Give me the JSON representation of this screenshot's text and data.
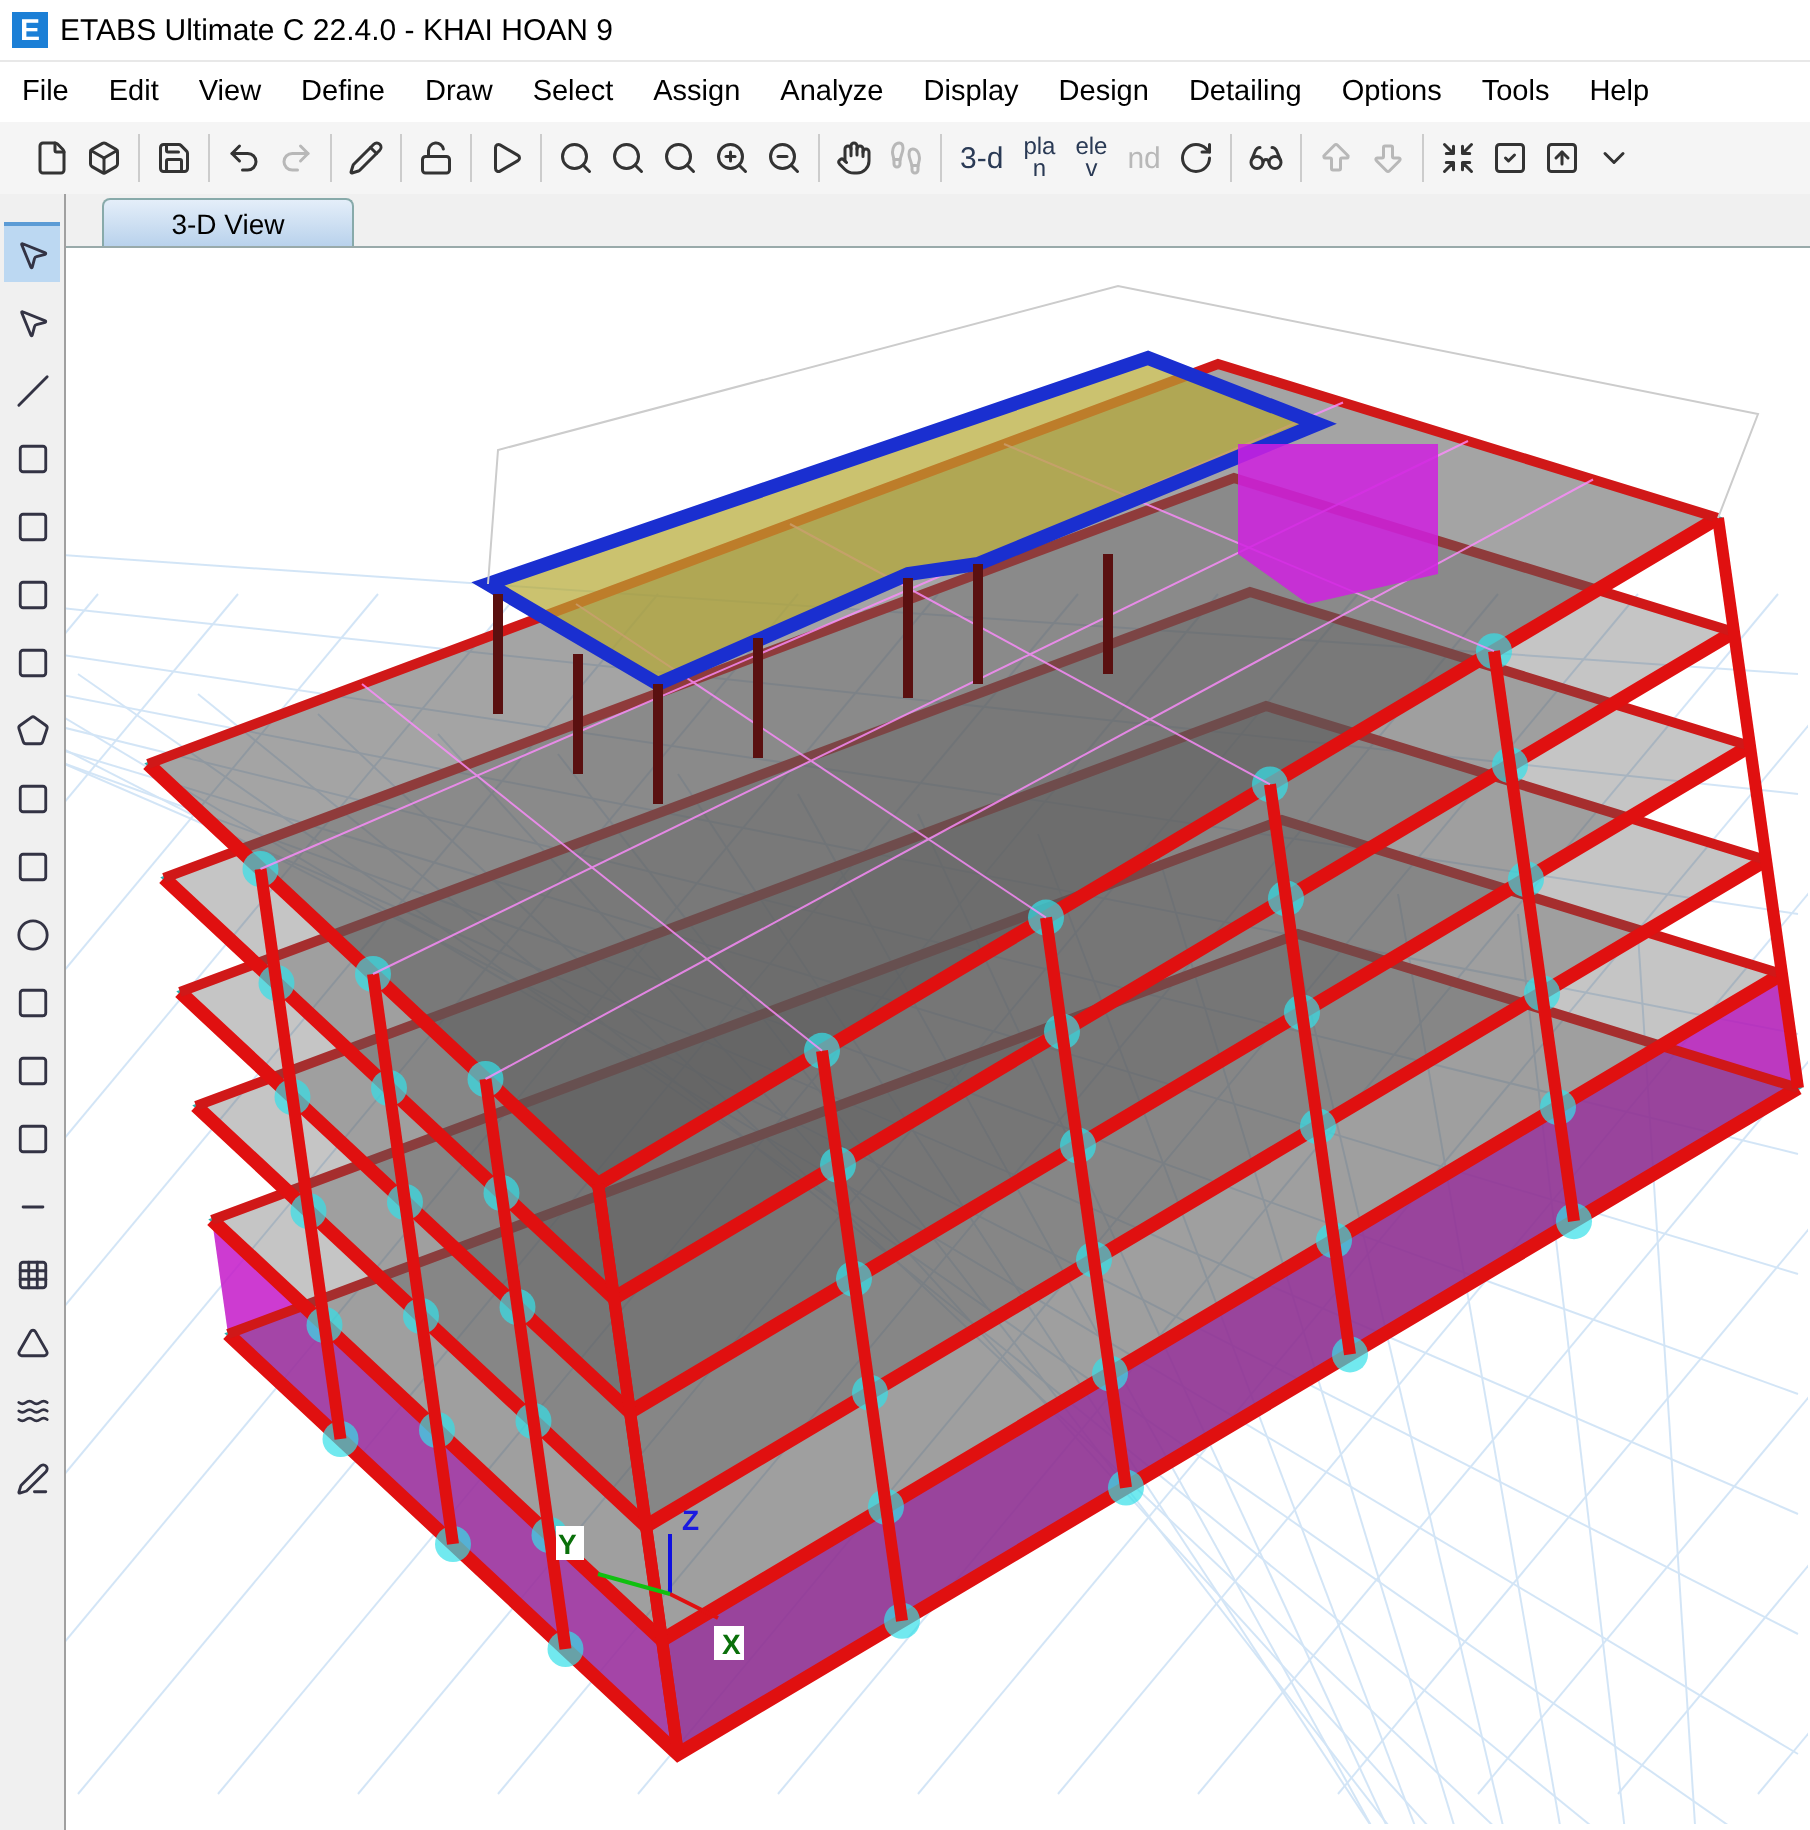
{
  "window": {
    "logo_letter": "E",
    "title": "ETABS Ultimate C 22.4.0 - KHAI HOAN 9"
  },
  "menu": [
    "File",
    "Edit",
    "View",
    "Define",
    "Draw",
    "Select",
    "Assign",
    "Analyze",
    "Display",
    "Design",
    "Detailing",
    "Options",
    "Tools",
    "Help"
  ],
  "toolbar_view_buttons": [
    {
      "kind": "text",
      "label": "3-d",
      "disabled": false
    },
    {
      "kind": "stacked",
      "top": "pla",
      "bottom": "n",
      "disabled": false
    },
    {
      "kind": "stacked",
      "top": "ele",
      "bottom": "v",
      "disabled": false
    },
    {
      "kind": "text",
      "label": "nd",
      "disabled": true
    }
  ],
  "tabs": [
    {
      "label": "3-D View",
      "selected": true
    }
  ],
  "side_tools": [
    {
      "selected": true
    },
    {
      "selected": false
    },
    {
      "selected": false
    },
    {
      "selected": false
    },
    {
      "selected": false
    },
    {
      "selected": false
    },
    {
      "selected": false
    },
    {
      "selected": false
    },
    {
      "selected": false
    },
    {
      "selected": false
    },
    {
      "selected": false
    },
    {
      "selected": false
    },
    {
      "selected": false
    },
    {
      "selected": false
    },
    {
      "selected": false
    },
    {
      "selected": false
    },
    {
      "selected": false
    },
    {
      "selected": false
    },
    {
      "selected": false
    }
  ],
  "axes": {
    "x": "X",
    "y": "Y",
    "z": "Z"
  }
}
